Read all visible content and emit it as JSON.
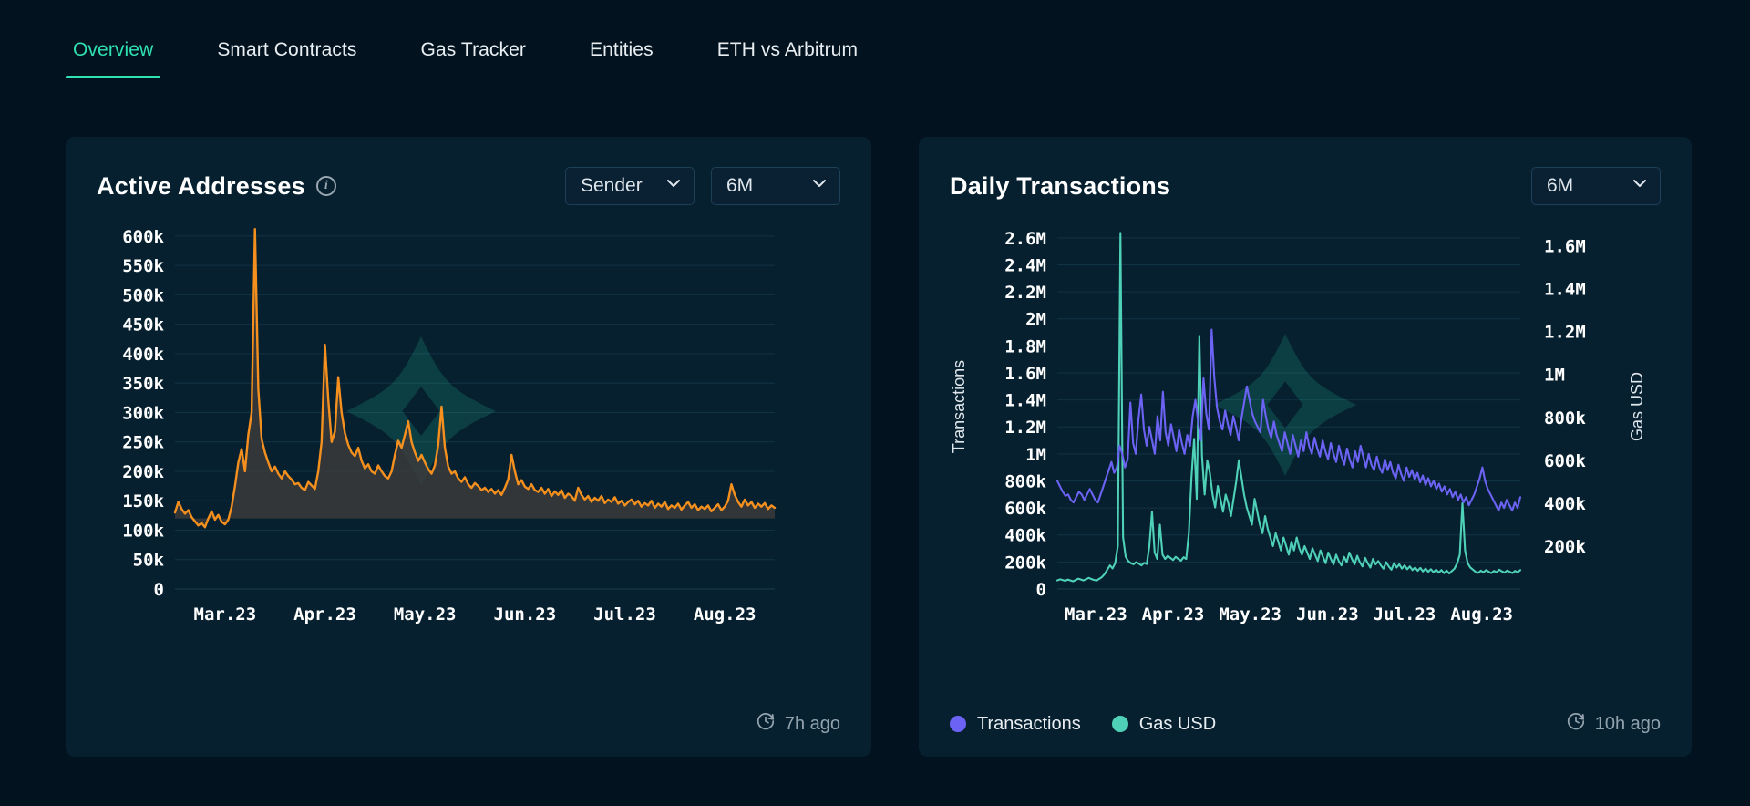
{
  "nav": {
    "tabs": [
      {
        "label": "Overview",
        "active": true
      },
      {
        "label": "Smart Contracts",
        "active": false
      },
      {
        "label": "Gas Tracker",
        "active": false
      },
      {
        "label": "Entities",
        "active": false
      },
      {
        "label": "ETH vs Arbitrum",
        "active": false
      }
    ]
  },
  "colors": {
    "accent": "#2fe0b0",
    "orange": "#f5901e",
    "purple": "#6c63f5",
    "teal": "#4fd1b8",
    "card_bg": "#06202f",
    "page_bg": "#02131f",
    "area_fill": "#3b3b3b",
    "grid": "#123246"
  },
  "cards": [
    {
      "title": "Active Addresses",
      "info_icon": "info-icon",
      "controls": [
        {
          "name": "sender-select",
          "value": "Sender",
          "icon": "chevron-down-icon"
        },
        {
          "name": "timeframe-select",
          "value": "6M",
          "icon": "chevron-down-icon"
        }
      ],
      "updated": {
        "icon": "clock-refresh-icon",
        "text": "7h ago"
      },
      "legend": []
    },
    {
      "title": "Daily Transactions",
      "controls": [
        {
          "name": "timeframe-select",
          "value": "6M",
          "icon": "chevron-down-icon"
        }
      ],
      "updated": {
        "icon": "clock-refresh-icon",
        "text": "10h ago"
      },
      "legend": [
        {
          "label": "Transactions",
          "color": "#6c63f5"
        },
        {
          "label": "Gas USD",
          "color": "#4fd1b8"
        }
      ]
    }
  ],
  "chart_data": [
    {
      "type": "area",
      "title": "Active Addresses",
      "xlabel": "",
      "ylabel": "",
      "ylim": [
        0,
        620000
      ],
      "grid": true,
      "legend_position": "none",
      "yticks": [
        "0",
        "50k",
        "100k",
        "150k",
        "200k",
        "250k",
        "300k",
        "350k",
        "400k",
        "450k",
        "500k",
        "550k",
        "600k"
      ],
      "ytick_values": [
        0,
        50000,
        100000,
        150000,
        200000,
        250000,
        300000,
        350000,
        400000,
        450000,
        500000,
        550000,
        600000
      ],
      "xticks": [
        "Mar.23",
        "Apr.23",
        "May.23",
        "Jun.23",
        "Jul.23",
        "Aug.23"
      ],
      "series": [
        {
          "name": "Active Addresses",
          "color": "#f5901e",
          "fill": "#3b3b3b",
          "fill_baseline": 120000,
          "values": [
            130000,
            148000,
            136000,
            128000,
            134000,
            122000,
            115000,
            108000,
            112000,
            105000,
            120000,
            132000,
            118000,
            126000,
            114000,
            110000,
            118000,
            140000,
            175000,
            215000,
            238000,
            200000,
            262000,
            300000,
            612000,
            340000,
            255000,
            232000,
            215000,
            200000,
            208000,
            196000,
            188000,
            200000,
            192000,
            186000,
            178000,
            180000,
            172000,
            168000,
            182000,
            176000,
            170000,
            200000,
            250000,
            415000,
            322000,
            250000,
            268000,
            360000,
            300000,
            265000,
            245000,
            232000,
            226000,
            240000,
            218000,
            205000,
            212000,
            200000,
            196000,
            210000,
            200000,
            192000,
            188000,
            200000,
            228000,
            252000,
            240000,
            262000,
            285000,
            250000,
            232000,
            218000,
            228000,
            215000,
            204000,
            196000,
            210000,
            245000,
            310000,
            240000,
            208000,
            196000,
            200000,
            188000,
            182000,
            190000,
            178000,
            172000,
            180000,
            175000,
            168000,
            172000,
            165000,
            170000,
            162000,
            168000,
            160000,
            172000,
            186000,
            228000,
            200000,
            178000,
            185000,
            174000,
            170000,
            178000,
            168000,
            165000,
            172000,
            162000,
            170000,
            158000,
            166000,
            160000,
            168000,
            155000,
            162000,
            158000,
            150000,
            172000,
            160000,
            152000,
            158000,
            148000,
            155000,
            150000,
            158000,
            146000,
            152000,
            148000,
            156000,
            145000,
            150000,
            142000,
            148000,
            152000,
            144000,
            150000,
            140000,
            146000,
            142000,
            150000,
            138000,
            145000,
            140000,
            148000,
            136000,
            142000,
            138000,
            145000,
            135000,
            142000,
            148000,
            138000,
            144000,
            134000,
            140000,
            136000,
            142000,
            132000,
            138000,
            144000,
            134000,
            140000,
            150000,
            178000,
            160000,
            148000,
            140000,
            152000,
            142000,
            148000,
            138000,
            145000,
            140000,
            146000,
            136000,
            142000,
            138000
          ]
        }
      ]
    },
    {
      "type": "line",
      "title": "Daily Transactions",
      "xlabel": "",
      "ylabel": "Transactions",
      "y2label": "Gas USD",
      "ylim": [
        0,
        2700000
      ],
      "y2lim": [
        0,
        1700000
      ],
      "grid": true,
      "legend_position": "bottom-left",
      "yticks": [
        "0",
        "200k",
        "400k",
        "600k",
        "800k",
        "1M",
        "1.2M",
        "1.4M",
        "1.6M",
        "1.8M",
        "2M",
        "2.2M",
        "2.4M",
        "2.6M"
      ],
      "ytick_values": [
        0,
        200000,
        400000,
        600000,
        800000,
        1000000,
        1200000,
        1400000,
        1600000,
        1800000,
        2000000,
        2200000,
        2400000,
        2600000
      ],
      "y2ticks": [
        "200k",
        "400k",
        "600k",
        "800k",
        "1M",
        "1.2M",
        "1.4M",
        "1.6M"
      ],
      "y2tick_values": [
        200000,
        400000,
        600000,
        800000,
        1000000,
        1200000,
        1400000,
        1600000
      ],
      "xticks": [
        "Mar.23",
        "Apr.23",
        "May.23",
        "Jun.23",
        "Jul.23",
        "Aug.23"
      ],
      "series": [
        {
          "name": "Transactions",
          "color": "#6c63f5",
          "axis": "left",
          "values": [
            800000,
            760000,
            720000,
            690000,
            700000,
            660000,
            640000,
            680000,
            720000,
            700000,
            660000,
            700000,
            740000,
            700000,
            660000,
            640000,
            700000,
            760000,
            820000,
            880000,
            940000,
            860000,
            900000,
            1060000,
            1000000,
            900000,
            960000,
            1380000,
            1080000,
            1000000,
            1260000,
            1440000,
            1180000,
            1060000,
            1200000,
            1100000,
            1000000,
            1280000,
            1100000,
            1460000,
            1160000,
            1060000,
            1220000,
            1120000,
            1020000,
            1180000,
            1080000,
            1000000,
            1140000,
            1060000,
            1280000,
            1400000,
            1240000,
            1100000,
            1560000,
            1300000,
            1180000,
            1920000,
            1560000,
            1340000,
            1240000,
            1180000,
            1320000,
            1220000,
            1140000,
            1280000,
            1200000,
            1100000,
            1260000,
            1380000,
            1500000,
            1400000,
            1300000,
            1240000,
            1200000,
            1160000,
            1400000,
            1280000,
            1180000,
            1120000,
            1240000,
            1140000,
            1080000,
            1020000,
            1160000,
            1080000,
            1000000,
            1140000,
            1060000,
            980000,
            1100000,
            1020000,
            1160000,
            1060000,
            1000000,
            1120000,
            1040000,
            980000,
            1100000,
            1020000,
            960000,
            1080000,
            1000000,
            940000,
            1060000,
            980000,
            920000,
            1040000,
            960000,
            900000,
            1020000,
            940000,
            1060000,
            980000,
            900000,
            1000000,
            920000,
            880000,
            980000,
            900000,
            860000,
            960000,
            880000,
            940000,
            860000,
            820000,
            920000,
            850000,
            800000,
            900000,
            830000,
            880000,
            810000,
            860000,
            790000,
            840000,
            770000,
            820000,
            760000,
            800000,
            740000,
            780000,
            720000,
            760000,
            700000,
            740000,
            680000,
            720000,
            660000,
            700000,
            640000,
            680000,
            620000,
            660000,
            700000,
            760000,
            820000,
            900000,
            800000,
            740000,
            700000,
            660000,
            620000,
            580000,
            640000,
            600000,
            660000,
            620000,
            580000,
            640000,
            600000,
            680000
          ]
        },
        {
          "name": "Gas USD",
          "color": "#4fd1b8",
          "axis": "right",
          "values": [
            40000,
            45000,
            42000,
            38000,
            44000,
            40000,
            36000,
            42000,
            48000,
            44000,
            40000,
            46000,
            52000,
            46000,
            42000,
            40000,
            48000,
            56000,
            70000,
            90000,
            110000,
            96000,
            120000,
            200000,
            1660000,
            240000,
            150000,
            130000,
            120000,
            115000,
            125000,
            118000,
            110000,
            122000,
            116000,
            200000,
            360000,
            170000,
            140000,
            300000,
            160000,
            140000,
            155000,
            145000,
            135000,
            150000,
            140000,
            132000,
            148000,
            140000,
            260000,
            520000,
            700000,
            420000,
            1180000,
            620000,
            440000,
            600000,
            540000,
            440000,
            380000,
            480000,
            420000,
            360000,
            440000,
            400000,
            340000,
            420000,
            500000,
            600000,
            520000,
            440000,
            380000,
            340000,
            300000,
            420000,
            360000,
            300000,
            260000,
            340000,
            280000,
            240000,
            200000,
            260000,
            220000,
            180000,
            240000,
            200000,
            160000,
            220000,
            180000,
            240000,
            190000,
            160000,
            200000,
            170000,
            140000,
            190000,
            160000,
            130000,
            180000,
            150000,
            120000,
            170000,
            140000,
            115000,
            160000,
            130000,
            110000,
            150000,
            125000,
            170000,
            140000,
            115000,
            155000,
            125000,
            105000,
            145000,
            120000,
            100000,
            140000,
            115000,
            130000,
            110000,
            95000,
            125000,
            105000,
            90000,
            120000,
            100000,
            115000,
            95000,
            110000,
            92000,
            105000,
            88000,
            100000,
            85000,
            98000,
            82000,
            95000,
            80000,
            92000,
            78000,
            90000,
            76000,
            88000,
            74000,
            86000,
            72000,
            84000,
            95000,
            120000,
            160000,
            400000,
            180000,
            120000,
            100000,
            90000,
            80000,
            75000,
            85000,
            78000,
            88000,
            80000,
            74000,
            84000,
            78000,
            90000,
            82000,
            76000,
            86000,
            80000,
            74000,
            84000,
            78000,
            88000
          ]
        }
      ]
    }
  ]
}
